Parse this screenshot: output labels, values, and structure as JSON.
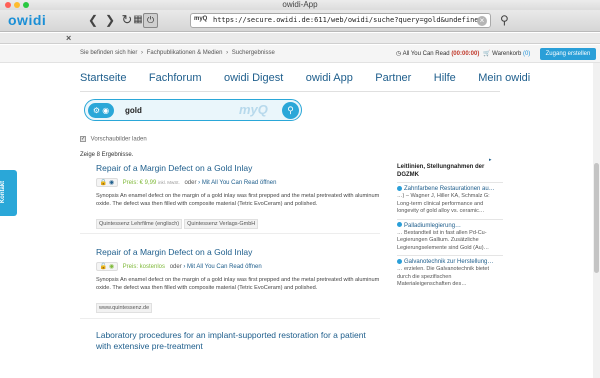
{
  "window": {
    "title": "owidi-App"
  },
  "toolbar": {
    "logo": "owidi",
    "back": "❮",
    "forward": "❯",
    "reload": "↻",
    "bookmarks": "▦",
    "home": "⏻",
    "url_badge": "myQ",
    "url": "https://secure.owidi.de:611/web/owidi/suche?query=gold&undefined",
    "url_clear": "×",
    "search_icon": "⚲"
  },
  "tabstrip": {
    "close": "×"
  },
  "utilbar": {
    "breadcrumb": [
      "Sie befinden sich hier",
      "Fachpublikationen & Medien",
      "Suchergebnisse"
    ],
    "breadcrumb_sep": "›",
    "ycr_icon": "◷",
    "ycr_label": "All You Can Read",
    "ycr_counter": "(00:00:00)",
    "cart_icon": "🛒",
    "cart_label": "Warenkorb",
    "cart_count": "(0)",
    "login_label": "Zugang erstellen"
  },
  "mainnav": [
    "Startseite",
    "Fachforum",
    "owidi Digest",
    "owidi App",
    "Partner",
    "Hilfe",
    "Mein owidi"
  ],
  "search": {
    "left_icon": "⚙ ◉",
    "value": "gold",
    "myq": "myQ",
    "go_icon": "⚲"
  },
  "preview": {
    "checkmark": "✓",
    "label": "Vorschaubilder laden"
  },
  "result_count": "Zeige 8 Ergebnisse.",
  "results": [
    {
      "title": "Repair of a Margin Defect on a Gold Inlay",
      "badge": "🔒 ◉",
      "price": "Preis: € 9,99",
      "vat": "inkl. MwSt.",
      "or": "oder",
      "ycr_link": "› Mit All You Can Read öffnen",
      "abstract": "Synopsis An enamel defect on the margin of a gold inlay was first prepped and the metal pretreated with aluminum oxide. The defect was then filled with composite material (Tetric EvoCeram) and polished.",
      "tags": [
        "Quintessenz Lehrfilme (englisch)",
        "Quintessenz Verlags-GmbH"
      ]
    },
    {
      "title": "Repair of a Margin Defect on a Gold Inlay",
      "badge": "🔓 ◉",
      "price": "Preis: kostenlos",
      "vat": "",
      "or": "oder",
      "ycr_link": "› Mit All You Can Read öffnen",
      "abstract": "Synopsis An enamel defect on the margin of a gold inlay was first prepped and the metal pretreated with aluminum oxide. The defect was then filled with composite material (Tetric EvoCeram) and polished.",
      "tags": [
        "www.quintessenz.de"
      ]
    },
    {
      "title": "Laboratory procedures for an implant-supported restoration for a patient with extensive pre-treatment"
    }
  ],
  "sidebar": {
    "caret": "▸",
    "title": "Leitlinien, Stellungnahmen der DGZMK",
    "items": [
      {
        "head": "Zahnfarbene Restaurationen au…",
        "body": "…) – Wagner J, Hiller KA, Schmalz G: Long-term clinical performance and longevity of gold alloy vs. ceramic…"
      },
      {
        "head": "Palladiumlegierung…",
        "body": "… Bestandteil ist in fast allen Pd-Cu-Legierungen Gallium. Zusätzliche Legierungselemente sind Gold (Au)…"
      },
      {
        "head": "Galvanotechnik zur Herstellung…",
        "body": "… erzielen. Die Galvanotechnik bietet durch die spezifischen Materialeigenschaften des…"
      }
    ]
  },
  "kontakt": "Kontakt",
  "colors": {
    "accent": "#2aa7d8",
    "link": "#1e5e8c",
    "price": "#7fb93a",
    "counter": "#c0392b"
  }
}
